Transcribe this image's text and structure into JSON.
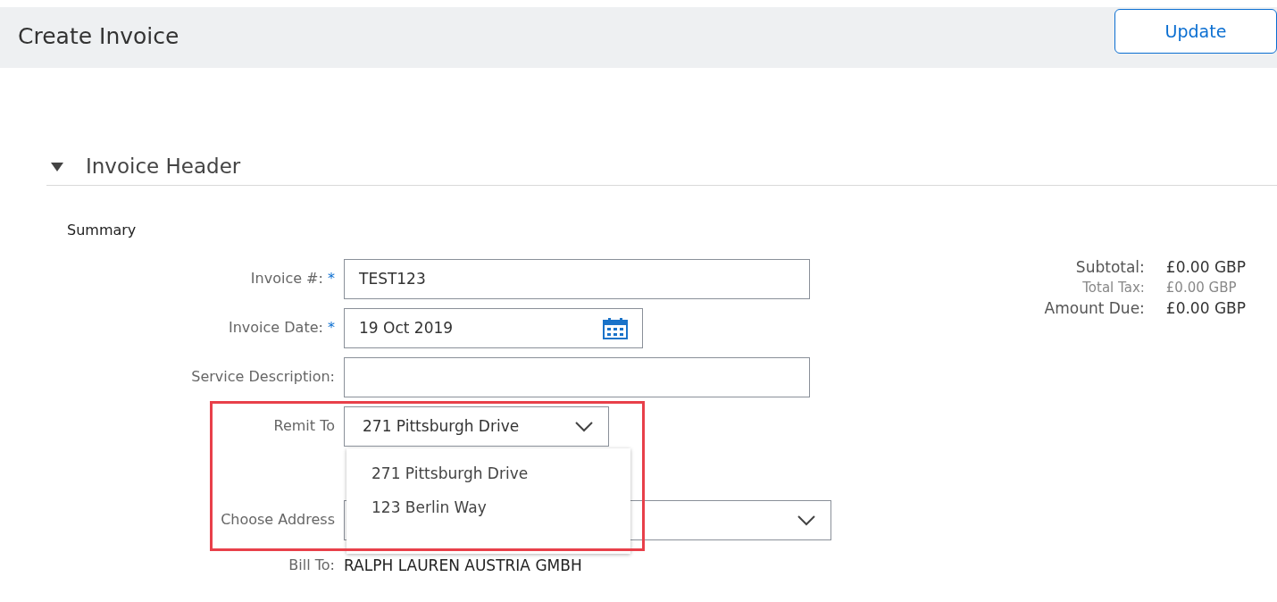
{
  "page": {
    "title": "Create Invoice",
    "update_button": "Update"
  },
  "section": {
    "title": "Invoice Header",
    "expanded": true,
    "subtitle": "Summary"
  },
  "fields": [
    {
      "label": "Invoice #:",
      "required_marker": "*",
      "kind": "text",
      "value": "TEST123"
    },
    {
      "label": "Invoice Date:",
      "required_marker": "*",
      "kind": "date",
      "value": "19 Oct 2019"
    },
    {
      "label": "Service Description:",
      "kind": "text"
    },
    {
      "label": "Remit To",
      "kind": "select",
      "value": "271 Pittsburgh Drive",
      "expanded": true,
      "options": [
        "271 Pittsburgh Drive",
        "123 Berlin Way"
      ]
    },
    {
      "label": "Choose Address",
      "kind": "select",
      "expanded": false
    },
    {
      "label": "Bill To:",
      "kind": "static",
      "value": "RALPH LAUREN AUSTRIA GMBH"
    }
  ],
  "totals": [
    {
      "label": "Subtotal:",
      "value": "£0.00 GBP",
      "muted": false
    },
    {
      "label": "Total Tax:",
      "value": "£0.00 GBP",
      "muted": true
    },
    {
      "label": "Amount Due:",
      "value": "£0.00 GBP",
      "muted": false
    }
  ]
}
